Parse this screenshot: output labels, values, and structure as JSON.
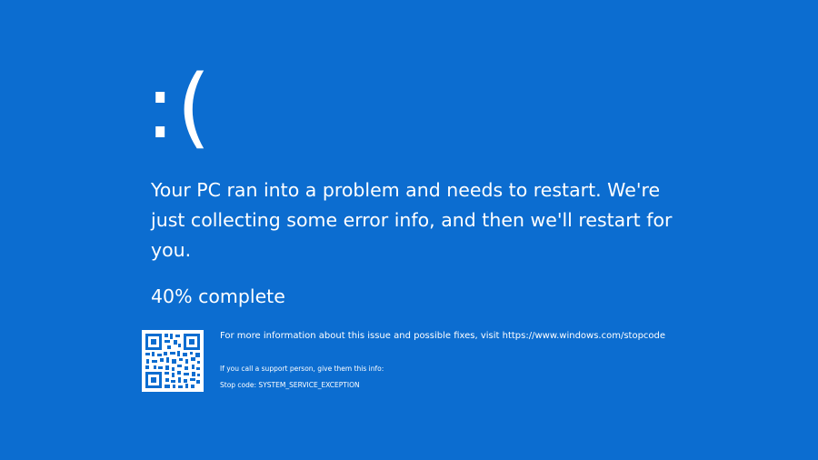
{
  "screen": {
    "sad_face": ":(",
    "message": "Your PC ran into a problem and needs to restart. We're just collecting some error info, and then we'll restart for you.",
    "progress_text": "40% complete",
    "progress_percent": 40,
    "more_info": "For more information about this issue and possible fixes, visit https://www.windows.com/stopcode",
    "support_prompt": "If you call a support person, give them this info:",
    "stop_code": "Stop code: SYSTEM_SERVICE_EXCEPTION"
  },
  "colors": {
    "background": "#0c6dd0",
    "text": "#ffffff"
  },
  "icons": {
    "qr_code": "qr-code-icon"
  }
}
